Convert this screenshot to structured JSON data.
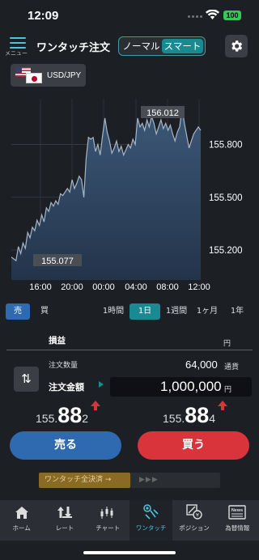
{
  "status": {
    "time": "12:09",
    "battery": "100"
  },
  "header": {
    "menu_label": "メニュー",
    "title": "ワンタッチ注文",
    "mode_tabs": [
      {
        "label": "ノーマル"
      },
      {
        "label": "スマート"
      }
    ],
    "selected_mode": "スマート"
  },
  "pair": {
    "label": "USD/JPY"
  },
  "chart_data": {
    "type": "area",
    "x_ticks": [
      "16:00",
      "20:00",
      "00:00",
      "04:00",
      "08:00",
      "12:00"
    ],
    "y_ticks": [
      "155.800",
      "155.500",
      "155.200"
    ],
    "ylim": [
      155.03,
      156.06
    ],
    "high_label": "156.012",
    "low_label": "155.077",
    "x": [
      0,
      1,
      2,
      3,
      4,
      5,
      6,
      7,
      8,
      9,
      10,
      11,
      12,
      13,
      14,
      15,
      16,
      17,
      18,
      19,
      20,
      21,
      22,
      23,
      24,
      25,
      26,
      27,
      28,
      29,
      30,
      31,
      32,
      33,
      34,
      35,
      36,
      37,
      38,
      39,
      40,
      41,
      42,
      43,
      44,
      45,
      46,
      47,
      48,
      49,
      50,
      51,
      52,
      53,
      54,
      55,
      56,
      57,
      58,
      59,
      60,
      61,
      62,
      63,
      64,
      65,
      66,
      67,
      68,
      69,
      70,
      71,
      72,
      73,
      74,
      75,
      76,
      77,
      78,
      79,
      80,
      81
    ],
    "values": [
      155.16,
      155.15,
      155.14,
      155.22,
      155.18,
      155.24,
      155.21,
      155.3,
      155.27,
      155.33,
      155.31,
      155.37,
      155.34,
      155.4,
      155.36,
      155.44,
      155.42,
      155.47,
      155.45,
      155.48,
      155.46,
      155.52,
      155.51,
      155.53,
      155.55,
      155.53,
      155.6,
      155.55,
      155.58,
      155.62,
      155.6,
      155.5,
      155.72,
      155.84,
      155.83,
      155.84,
      155.76,
      155.8,
      155.74,
      155.85,
      155.95,
      155.87,
      155.82,
      155.75,
      155.78,
      155.82,
      155.76,
      155.79,
      155.74,
      155.77,
      155.8,
      155.78,
      155.83,
      155.8,
      155.95,
      155.9,
      155.92,
      155.88,
      155.94,
      155.9,
      155.96,
      155.92,
      155.86,
      155.9,
      155.94,
      155.89,
      155.92,
      155.88,
      155.91,
      155.86,
      155.82,
      155.87,
      155.9,
      156.01,
      155.92,
      155.85,
      155.78,
      155.82,
      155.86,
      155.88,
      155.9,
      155.88
    ]
  },
  "timeframe": {
    "side_tabs": [
      {
        "label": "売"
      },
      {
        "label": "買"
      }
    ],
    "periods": [
      {
        "label": "1時間"
      },
      {
        "label": "1日"
      },
      {
        "label": "1週間"
      },
      {
        "label": "1ヶ月"
      },
      {
        "label": "1年"
      }
    ]
  },
  "pnl": {
    "label": "損益",
    "unit": "円"
  },
  "order": {
    "qty_label": "注文数量",
    "qty_value": "64,000",
    "qty_unit": "通貨",
    "amount_label": "注文金額",
    "amount_value": "1,000,000",
    "amount_unit": "円"
  },
  "quotes": {
    "sell": {
      "a": "155.",
      "b": "88",
      "c": "2"
    },
    "buy": {
      "a": "155.",
      "b": "88",
      "c": "4"
    }
  },
  "buttons": {
    "sell": "売る",
    "buy": "買う"
  },
  "settle": {
    "label": "ワンタッチ全決済 →",
    "chevrons": "▶▶▶"
  },
  "tabs": [
    {
      "label": "ホーム"
    },
    {
      "label": "レート"
    },
    {
      "label": "チャート"
    },
    {
      "label": "ワンタッチ"
    },
    {
      "label": "ポジション"
    },
    {
      "label": "為替情報"
    }
  ],
  "tab_news_badge": "News",
  "colors": {
    "accent": "#1a8a92",
    "sell": "#2f6ab0",
    "buy": "#d9333b",
    "up_arrow": "#d9333b"
  }
}
